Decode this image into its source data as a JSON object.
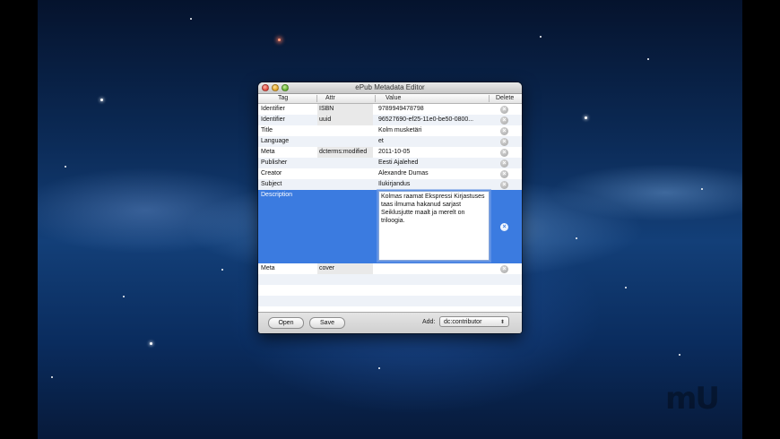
{
  "window": {
    "title": "ePub Metadata Editor"
  },
  "columns": {
    "tag": "Tag",
    "attr": "Attr",
    "value": "Value",
    "delete": "Delete"
  },
  "rows": [
    {
      "tag": "Identifier",
      "attr": "ISBN",
      "value": "9789949478798"
    },
    {
      "tag": "Identifier",
      "attr": "uuid",
      "value": "96527690-ef25-11e0-be50-0800..."
    },
    {
      "tag": "Title",
      "attr": "",
      "value": "Kolm musketäri"
    },
    {
      "tag": "Language",
      "attr": "",
      "value": "et"
    },
    {
      "tag": "Meta",
      "attr": "dcterms:modified",
      "value": "2011-10-05"
    },
    {
      "tag": "Publisher",
      "attr": "",
      "value": "Eesti Ajalehed"
    },
    {
      "tag": "Creator",
      "attr": "",
      "value": "Alexandre Dumas"
    },
    {
      "tag": "Subject",
      "attr": "",
      "value": "Ilukirjandus"
    },
    {
      "tag": "Description",
      "attr": "",
      "value": "Kolmas raamat Ekspressi Kirjastuses taas ilmuma hakanud sarjast Seiklusjutte maalt ja merelt on triloogia."
    },
    {
      "tag": "Meta",
      "attr": "cover",
      "value": ""
    }
  ],
  "delete_icon": "×",
  "bottombar": {
    "open_label": "Open",
    "save_label": "Save",
    "add_label": "Add:",
    "add_select_value": "dc:contributor",
    "add_select_arrows": "⬍"
  },
  "watermark": "mU",
  "colors": {
    "selection": "#3b7be0",
    "window_bg": "#ececec"
  }
}
